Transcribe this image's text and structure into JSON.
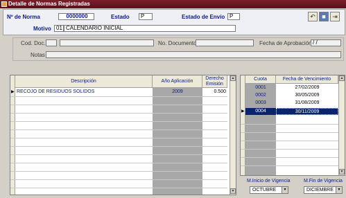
{
  "window": {
    "title": "Detalle de Normas Registradas"
  },
  "header": {
    "norma_label": "Nº de Norma",
    "norma_value": "0000000",
    "estado_label": "Estado",
    "estado_value": "P",
    "envio_label": "Estado de Envío",
    "envio_value": "P",
    "motivo_label": "Motivo",
    "motivo_code": "01",
    "motivo_desc": "CALENDARIO INICIAL"
  },
  "toolbar": {
    "icons": [
      "undo-icon",
      "save-icon",
      "exit-icon"
    ]
  },
  "doc": {
    "cod_label": "Cod. Doc.",
    "cod_value": "",
    "cod_desc": "",
    "nodoc_label": "No. Documento",
    "nodoc_value": "",
    "fecha_label": "Fecha de Aprobación",
    "fecha_value": "/ /",
    "notas_label": "Notas",
    "notas_value": ""
  },
  "left_grid": {
    "headers": [
      "Descripción",
      "Año Aplicación",
      "Derecho Emisión"
    ],
    "rows": [
      {
        "desc": "RECOJO DE RESIDUOS SOLIDOS",
        "anio": "2009",
        "derecho": "0.500"
      }
    ]
  },
  "right_grid": {
    "headers": [
      "Cuota",
      "Fecha de Vencimiento"
    ],
    "rows": [
      {
        "cuota": "0001",
        "fecha": "27/02/2009"
      },
      {
        "cuota": "0002",
        "fecha": "30/05/2009"
      },
      {
        "cuota": "0003",
        "fecha": "31/08/2009"
      },
      {
        "cuota": "0004",
        "fecha": "30/11/2009"
      }
    ],
    "selected_index": 3
  },
  "vigencia": {
    "inicio_label": "M.Inicio de Vigencia",
    "inicio_value": "OCTUBRE",
    "fin_label": "M.Fin de Vigencia",
    "fin_value": "DICIEMBRE"
  },
  "colors": {
    "title_bar": "#6a1525",
    "label_blue": "#0a1a80",
    "selection": "#0a246a",
    "grid_gray": "#a8a8a8"
  }
}
